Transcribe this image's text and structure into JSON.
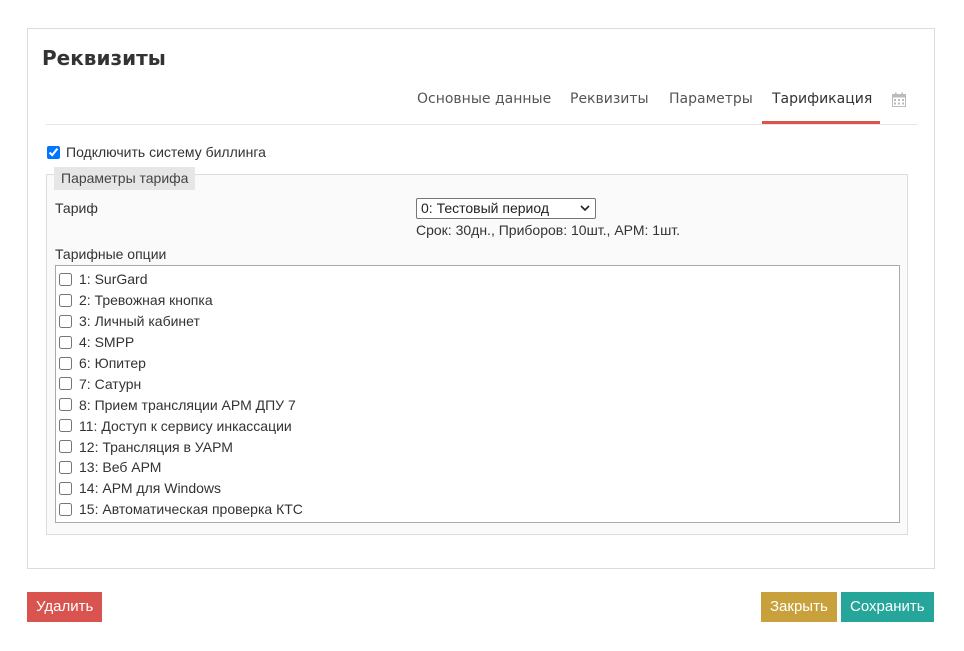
{
  "page": {
    "title": "Реквизиты"
  },
  "tabs": [
    {
      "label": "Основные данные"
    },
    {
      "label": "Реквизиты"
    },
    {
      "label": "Параметры"
    },
    {
      "label": "Тарификация",
      "active": true
    }
  ],
  "tab_icon": "calendar-icon",
  "billing": {
    "label": "Подключить систему биллинга",
    "checked": true
  },
  "tariff_params": {
    "legend": "Параметры тарифа",
    "tariff_label": "Тариф",
    "tariff_selected": "0: Тестовый период",
    "tariff_info": "Срок: 30дн., Приборов: 10шт., АРМ: 1шт.",
    "options_label": "Тарифные опции",
    "options": [
      {
        "label": "1: SurGard",
        "checked": false
      },
      {
        "label": "2: Тревожная кнопка",
        "checked": false
      },
      {
        "label": "3: Личный кабинет",
        "checked": false
      },
      {
        "label": "4: SMPP",
        "checked": false
      },
      {
        "label": "6: Юпитер",
        "checked": false
      },
      {
        "label": "7: Сатурн",
        "checked": false
      },
      {
        "label": "8: Прием трансляции АРМ ДПУ 7",
        "checked": false
      },
      {
        "label": "11: Доступ к сервису инкассации",
        "checked": false
      },
      {
        "label": "12: Трансляция в УАРМ",
        "checked": false
      },
      {
        "label": "13: Веб АРМ",
        "checked": false
      },
      {
        "label": "14: АРМ для Windows",
        "checked": false
      },
      {
        "label": "15: Автоматическая проверка КТС",
        "checked": false
      }
    ]
  },
  "buttons": {
    "delete": "Удалить",
    "close": "Закрыть",
    "save": "Сохранить"
  },
  "colors": {
    "tab_active": "#d9534f",
    "delete": "#d9534f",
    "close": "#c9a13c",
    "save": "#26a69a"
  }
}
